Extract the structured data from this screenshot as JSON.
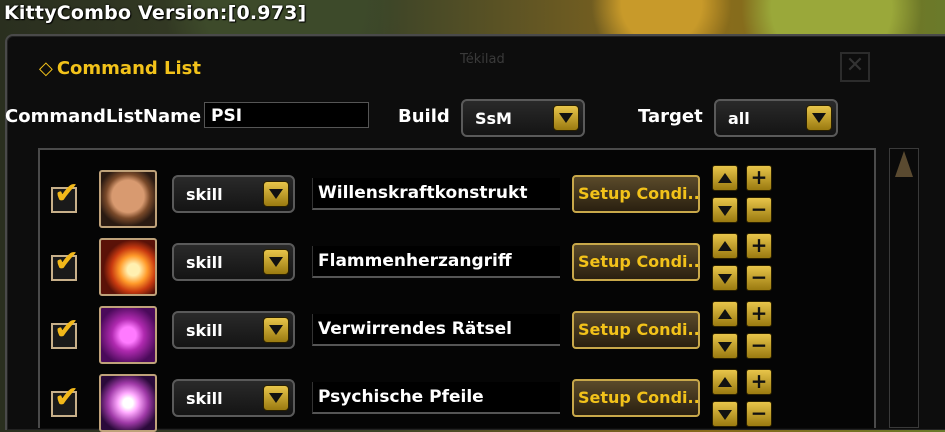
{
  "app": {
    "title": "KittyCombo Version:[0.973]"
  },
  "window": {
    "header": "Command List",
    "ghost_title": "Tékilad"
  },
  "toolbar": {
    "name_label": "CommandListName",
    "name_value": "PSI",
    "build_label": "Build",
    "build_value": "SsM",
    "target_label": "Target",
    "target_value": "all"
  },
  "rows": [
    {
      "enabled": true,
      "icon": "willenskraft-skill-icon",
      "type": "skill",
      "name": "Willenskraftkonstrukt",
      "setup_label": "Setup Condi..."
    },
    {
      "enabled": true,
      "icon": "flammenherz-skill-icon",
      "type": "skill",
      "name": "Flammenherzangriff",
      "setup_label": "Setup Condi..."
    },
    {
      "enabled": true,
      "icon": "raetsel-skill-icon",
      "type": "skill",
      "name": "Verwirrendes Rätsel",
      "setup_label": "Setup Condi..."
    },
    {
      "enabled": true,
      "icon": "pfeile-skill-icon",
      "type": "skill",
      "name": "Psychische Pfeile",
      "setup_label": "Setup Condi..."
    }
  ],
  "glyphs": {
    "plus": "+",
    "minus": "−",
    "check": "✔",
    "diamond": "◇",
    "close": "✕"
  },
  "colors": {
    "accent": "#f2c21a",
    "button_border": "#c8a84a"
  }
}
